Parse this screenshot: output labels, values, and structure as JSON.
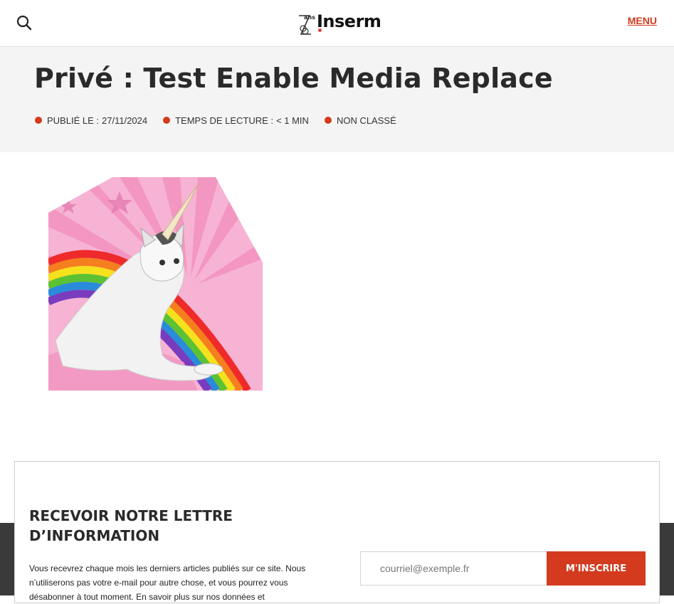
{
  "header": {
    "search_icon": "search-icon",
    "logo_prefix": "ans",
    "logo_text": "Inserm",
    "menu_label": "MENU"
  },
  "article": {
    "title": "Privé : Test Enable Media Replace",
    "meta": [
      {
        "key": "PUBLIÉ LE :",
        "value": "27/11/2024"
      },
      {
        "key": "TEMPS DE LECTURE :",
        "value": "< 1 MIN"
      },
      {
        "key": "NON CLASSÉ",
        "value": ""
      }
    ],
    "image_subject": "unicorn-cat-rainbow"
  },
  "newsletter": {
    "title": "RECEVOIR NOTRE LETTRE D’INFORMATION",
    "description": "Vous recevrez chaque mois les derniers articles publiés sur ce site. Nous n’utiliserons pas votre e-mail pour autre chose, et vous pourrez vous désabonner à tout moment. En savoir plus sur nos données et",
    "email_placeholder": "courriel@exemple.fr",
    "submit_label": "M'INSCRIRE"
  },
  "colors": {
    "accent": "#d33a1e",
    "title_band": "#f4f4f4",
    "dark_band": "#3a3a3a"
  }
}
